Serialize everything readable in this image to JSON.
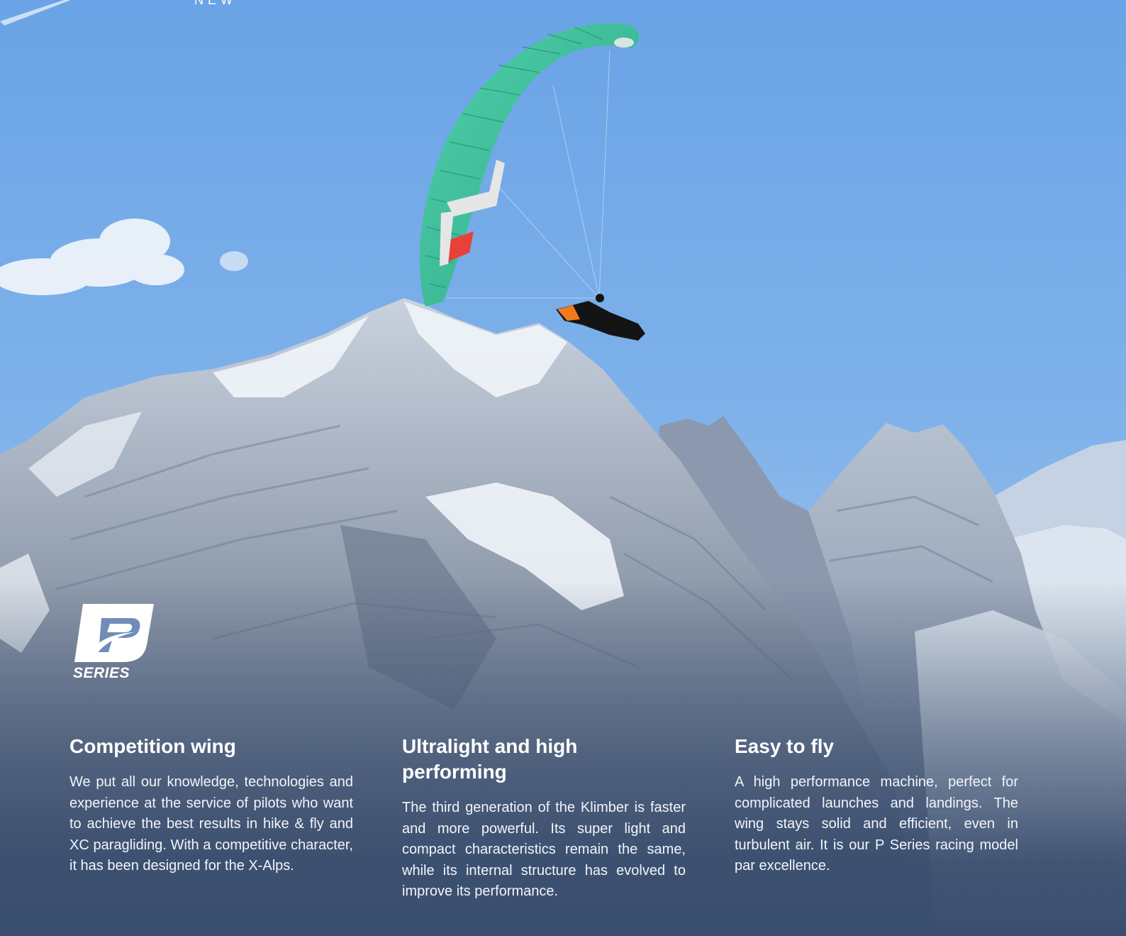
{
  "hero": {
    "new_label": "NEW",
    "logo_label": "SERIES",
    "logo_icon": "p-series-logo-icon",
    "colors": {
      "sky_top": "#6fa6e6",
      "sky_bottom": "#a8c8ec",
      "wing": "#3fbf9a",
      "wing_accent": "#e8403a",
      "mountain": "#9aa6b8",
      "snow": "#eef2f7",
      "overlay": "#3a4e6e"
    }
  },
  "features": [
    {
      "title": "Competition wing",
      "body": "We put all our knowledge, technologies and experience at the service of pilots who want to achieve the best results in hike & fly and XC paragliding. With a competitive character, it has been designed for the X-Alps."
    },
    {
      "title": "Ultralight and high performing",
      "body": "The third generation of the Klimber is faster and more powerful. Its super light and compact characteristics remain the same, while its internal structure has evolved to improve its performance."
    },
    {
      "title": "Easy to fly",
      "body": "A high performance machine, perfect for complicated launches and landings. The wing stays solid and efficient, even in turbulent air. It is our P Series racing model par excellence."
    }
  ]
}
